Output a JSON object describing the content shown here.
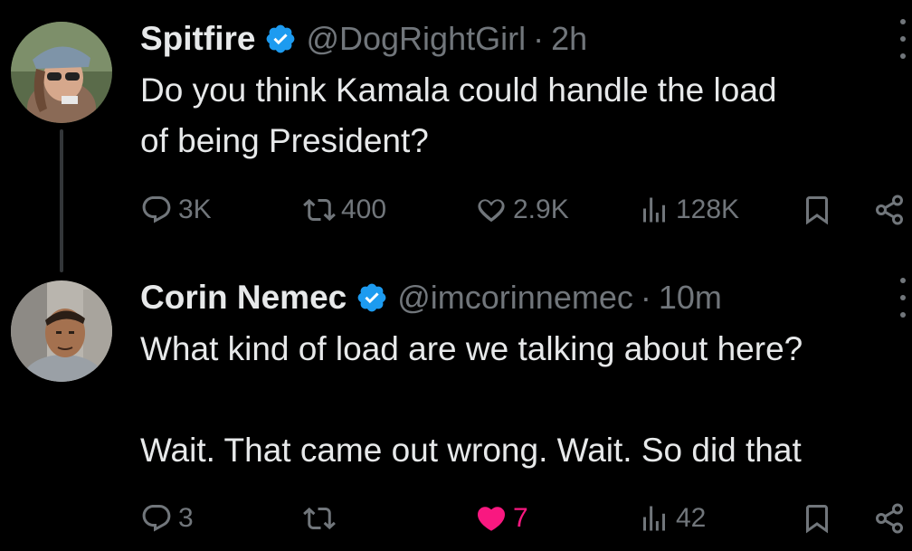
{
  "tweets": [
    {
      "name": "Spitfire",
      "handle": "@DogRightGirl",
      "separator": "·",
      "time": "2h",
      "text": "Do you think Kamala could handle the load\nof being President?",
      "replies": "3K",
      "reposts": "400",
      "likes": "2.9K",
      "views": "128K",
      "liked": false
    },
    {
      "name": "Corin Nemec",
      "handle": "@imcorinnemec",
      "separator": "·",
      "time": "10m",
      "text": "What kind of load are we talking about here?\n\nWait. That came out wrong. Wait. So did that",
      "replies": "3",
      "reposts": "",
      "likes": "7",
      "views": "42",
      "liked": true
    }
  ],
  "colors": {
    "background": "#000000",
    "text": "#e7e9ea",
    "secondary": "#71767b",
    "verified": "#1d9bf0",
    "like": "#f91880"
  }
}
